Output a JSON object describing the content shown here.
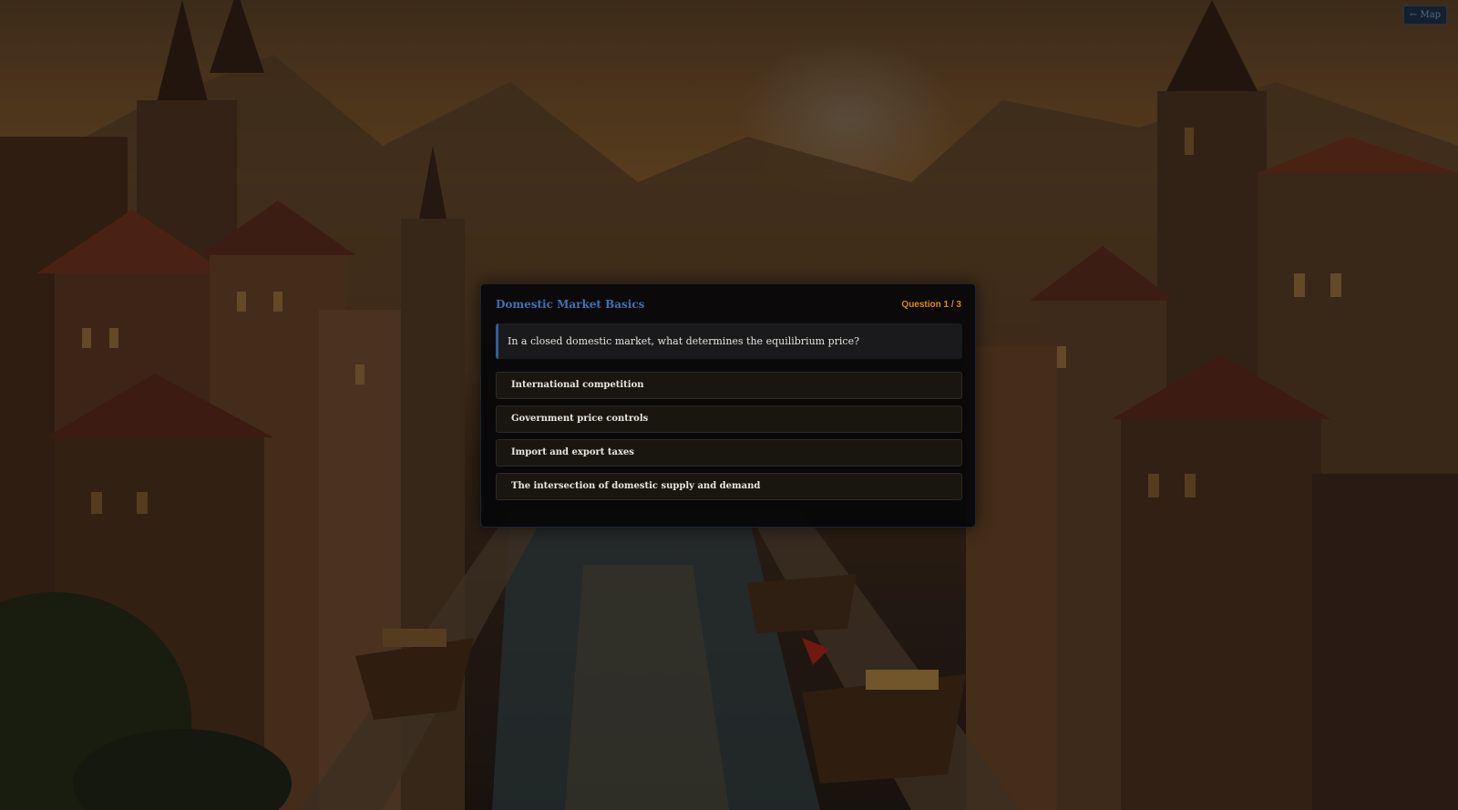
{
  "nav": {
    "map_button_label": "← Map"
  },
  "quiz": {
    "title": "Domestic Market Basics",
    "counter": "Question 1 / 3",
    "question": "In a closed domestic market, what determines the equilibrium price?",
    "answers": [
      {
        "label": "International competition"
      },
      {
        "label": "Government price controls"
      },
      {
        "label": "Import and export taxes"
      },
      {
        "label": "The intersection of domestic supply and demand"
      }
    ]
  },
  "colors": {
    "title_accent": "#3e72b8",
    "counter_accent": "#e08a14",
    "question_bar": "#2f5f9a"
  }
}
